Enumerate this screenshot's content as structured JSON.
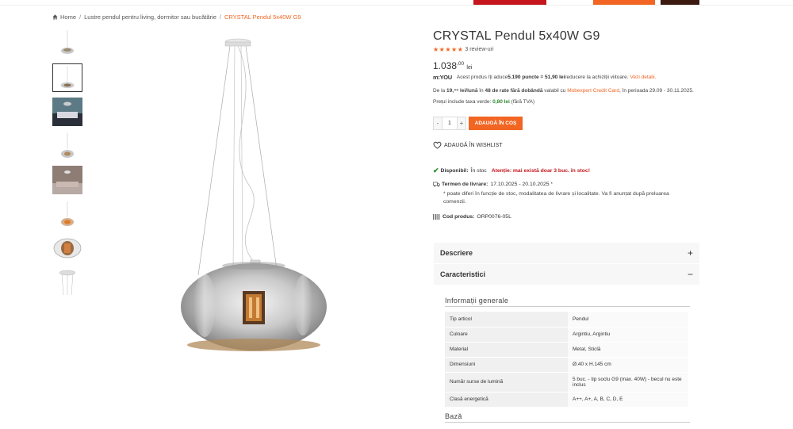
{
  "breadcrumb": {
    "home": "Home",
    "category": "Lustre pendul pentru living, dormitor sau bucătărie",
    "current": "CRYSTAL Pendul 5x40W G9"
  },
  "product": {
    "title": "CRYSTAL Pendul 5x40W G9",
    "rating_stars": "★★★★★",
    "reviews": "3 review-uri",
    "price_main": "1.038",
    "price_decimals": ",00",
    "currency": "lei"
  },
  "points": {
    "logo_main": "m:YOU",
    "logo_sub": "",
    "text1": "Acest produs îți aduce ",
    "points_value": "5.190 puncte = 51,90 lei",
    "text2": " reducere la achiziții viitoare.",
    "link": "Vezi detalii."
  },
  "rates": {
    "text1": "De la ",
    "amount": "19,⁴⁶ lei/lună",
    "text2": " în ",
    "count": "48 de rate fără dobândă",
    "text3": " valabil cu ",
    "card": "Mobexpert Credit Card",
    "text4": ", în perioada 29.09 - 30.11.2025."
  },
  "green_tax": {
    "text1": "Prețul include taxa verde: ",
    "value": "0,80 lei",
    "text2": " (fără TVA)"
  },
  "cart": {
    "minus": "-",
    "quantity": "1",
    "plus": "+",
    "add_label": "ADAUGĂ ÎN COȘ"
  },
  "wishlist_label": "ADAUGĂ ÎN WISHLIST",
  "stock": {
    "label": "Disponibil:",
    "status": "În stoc",
    "warning": "Atenție: mai există doar  3  buc. în stoc!"
  },
  "delivery": {
    "label": "Termen de livrare:",
    "dates": "17.10.2025 - 20.10.2025",
    "asterisk": "*",
    "note": "* poate diferi în funcție de stoc, modalitatea de livrare și localitate. Va fi anunțat după preluarea comenzii."
  },
  "code": {
    "label": "Cod produs:",
    "value": "ORP0076-05L"
  },
  "accordion": {
    "description": "Descriere",
    "description_sign": "+",
    "characteristics": "Caracteristici",
    "characteristics_sign": "−"
  },
  "specs": {
    "general_title": "Informații generale",
    "rows": [
      {
        "k": "Tip articol",
        "v": "Pendul"
      },
      {
        "k": "Culoare",
        "v": "Argintiu, Argintiu"
      },
      {
        "k": "Material",
        "v": "Metal, Sticlă"
      },
      {
        "k": "Dimensiuni",
        "v": "Ø.40 x H.145 cm"
      },
      {
        "k": "Număr surse de lumină",
        "v": "5 buc. - tip soclu G9 (max. 40W) - becul nu este inclus"
      },
      {
        "k": "Clasă energetică",
        "v": "A++, A+, A, B, C, D, E"
      }
    ],
    "base_title": "Bază"
  },
  "colors": {
    "accent": "#f26522",
    "stock_green": "#2e8b2e",
    "warning_red": "#c4161c"
  }
}
